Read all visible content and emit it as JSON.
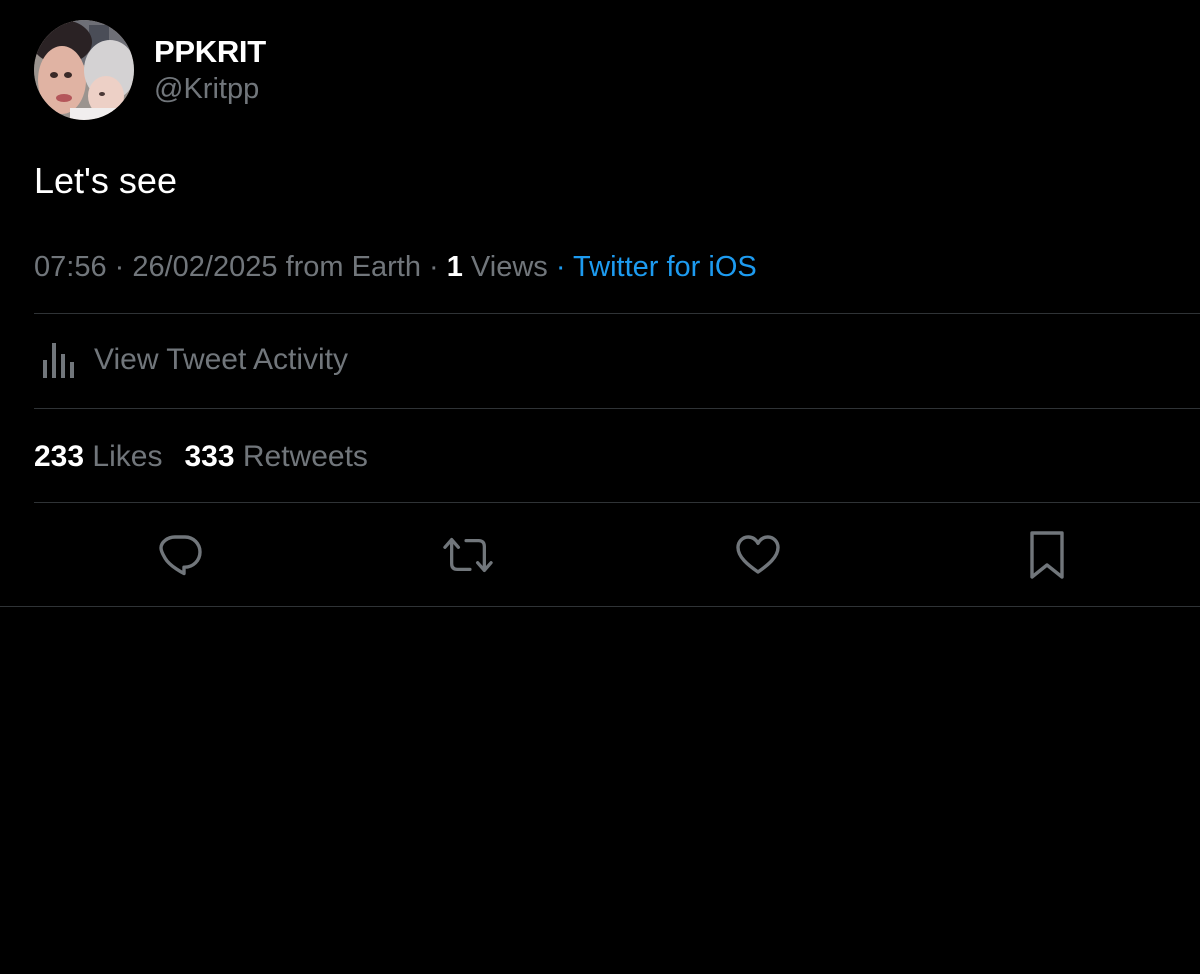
{
  "tweet": {
    "author": {
      "display_name": "PPKRIT",
      "handle": "@Kritpp"
    },
    "text": "Let's see",
    "meta": {
      "time": "07:56",
      "sep1": " · ",
      "date": "26/02/2025",
      "location": " from Earth",
      "sep2": " · ",
      "views_count": "1",
      "views_label": " Views",
      "sep3": " · ",
      "source": "Twitter for iOS"
    },
    "activity_label": "View Tweet Activity",
    "stats": {
      "likes_count": "233",
      "likes_label": "Likes",
      "retweets_count": "333",
      "retweets_label": "Retweets"
    },
    "actions": [
      {
        "name": "reply",
        "icon": "reply-icon"
      },
      {
        "name": "retweet",
        "icon": "retweet-icon"
      },
      {
        "name": "like",
        "icon": "heart-icon"
      },
      {
        "name": "bookmark",
        "icon": "bookmark-icon"
      }
    ]
  },
  "colors": {
    "background": "#000000",
    "text_primary": "#ffffff",
    "text_secondary": "#71767b",
    "link": "#1d9bf0",
    "divider": "#2f3336"
  }
}
